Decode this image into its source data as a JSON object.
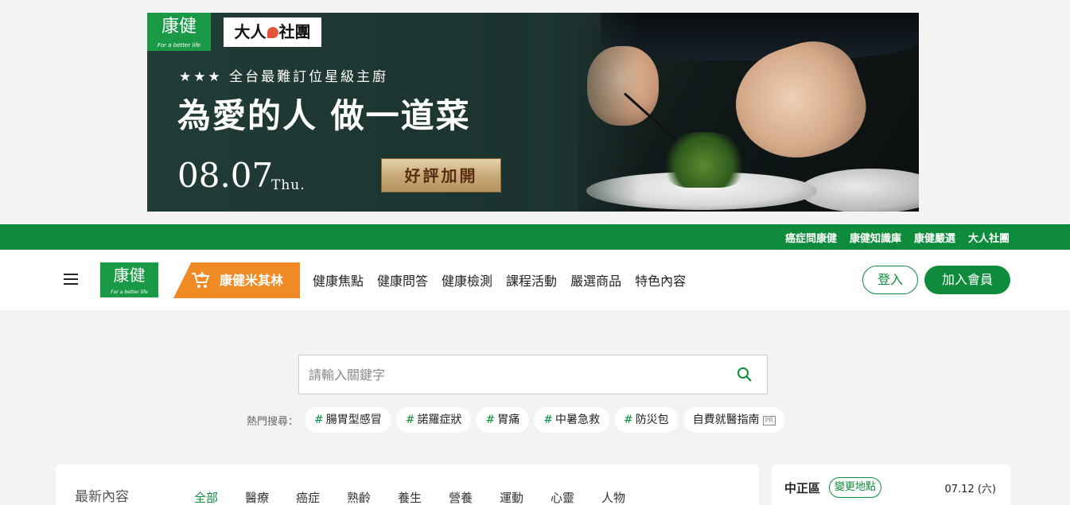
{
  "banner": {
    "logo_text": "康健",
    "logo_tagline": "For a better life",
    "partner_logo_before": "大人",
    "partner_logo_after": "社團",
    "subtitle": "★★★ 全台最難訂位星級主廚",
    "title": "為愛的人 做一道菜",
    "date": "08.07",
    "weekday": "Thu.",
    "cta": "好評加開"
  },
  "topbar": {
    "links": [
      "癌症問康健",
      "康健知識庫",
      "康健嚴選",
      "大人社團"
    ]
  },
  "nav": {
    "logo_text": "康健",
    "logo_tagline": "For a better life",
    "michelin_label": "康健米其林",
    "menu": [
      "健康焦點",
      "健康問答",
      "健康檢測",
      "課程活動",
      "嚴選商品",
      "特色內容"
    ],
    "login_label": "登入",
    "join_label": "加入會員"
  },
  "search": {
    "placeholder": "請輸入關鍵字",
    "hot_label": "熱門搜尋：",
    "hot_tags": [
      "腸胃型感冒",
      "諾羅症狀",
      "胃痛",
      "中暑急救",
      "防災包"
    ],
    "sponsored_tag": "自費就醫指南",
    "sponsored_badge": "PR",
    "hash": "#"
  },
  "latest": {
    "title": "最新內容",
    "categories": [
      "全部",
      "醫療",
      "癌症",
      "熟齡",
      "養生",
      "營養",
      "運動",
      "心靈",
      "人物"
    ],
    "active_category": "全部"
  },
  "weather": {
    "district": "中正區",
    "change_location_label": "變更地點",
    "date": "07.12 (六)"
  },
  "colors": {
    "brand_green": "#0f8c3b",
    "michelin_orange": "#f08a24"
  }
}
